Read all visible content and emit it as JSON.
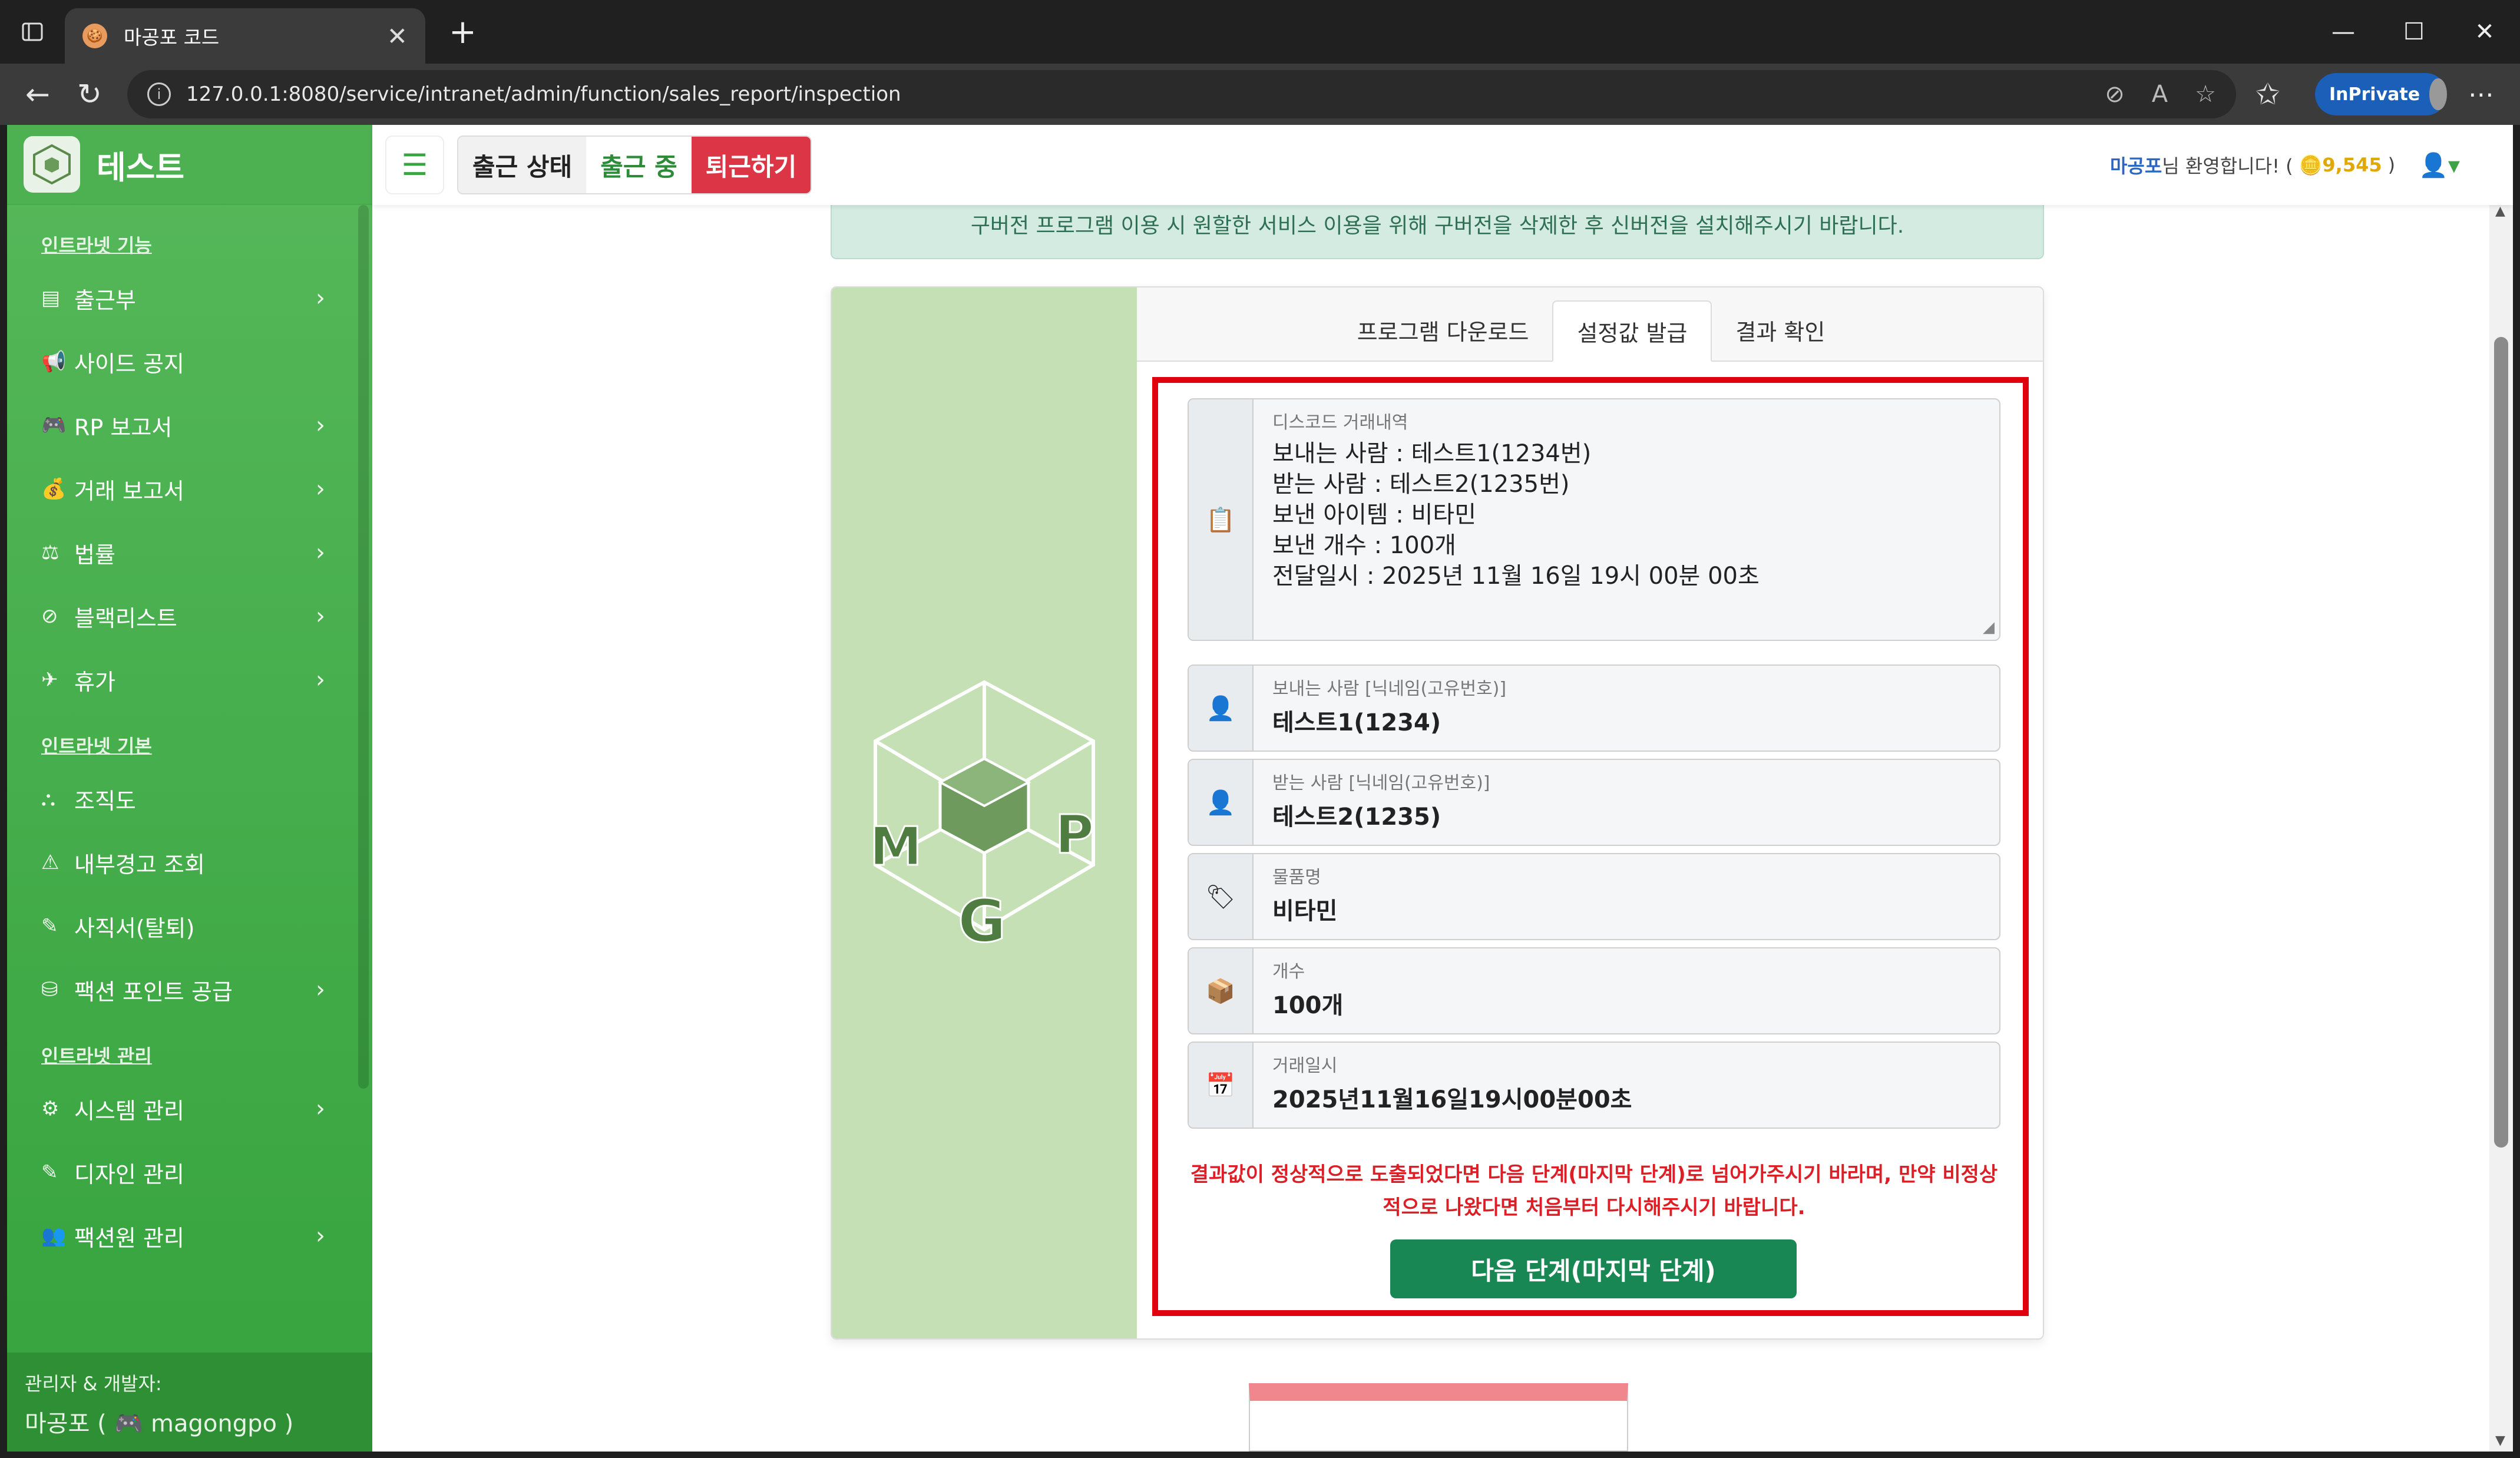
{
  "browser": {
    "tab_title": "마공포 코드",
    "favicon_glyph": "🍪",
    "url": "127.0.0.1:8080/service/intranet/admin/function/sales_report/inspection",
    "inprivate_label": "InPrivate"
  },
  "brand": {
    "name": "테스트"
  },
  "sidebar": {
    "sections": [
      {
        "heading": "인트라넷 기능",
        "items": [
          {
            "label": "출근부",
            "icon": "book-icon",
            "glyph": "▤",
            "chevron": true
          },
          {
            "label": "사이드 공지",
            "icon": "megaphone-icon",
            "glyph": "📢",
            "chevron": false
          },
          {
            "label": "RP 보고서",
            "icon": "gamepad-icon",
            "glyph": "🎮",
            "chevron": true
          },
          {
            "label": "거래 보고서",
            "icon": "money-bag-icon",
            "glyph": "💰",
            "chevron": true
          },
          {
            "label": "법률",
            "icon": "scale-icon",
            "glyph": "⚖",
            "chevron": true
          },
          {
            "label": "블랙리스트",
            "icon": "ban-icon",
            "glyph": "⊘",
            "chevron": true
          },
          {
            "label": "휴가",
            "icon": "plane-icon",
            "glyph": "✈",
            "chevron": true
          }
        ]
      },
      {
        "heading": "인트라넷 기본",
        "items": [
          {
            "label": "조직도",
            "icon": "sitemap-icon",
            "glyph": "⛬",
            "chevron": false
          },
          {
            "label": "내부경고 조회",
            "icon": "warning-icon",
            "glyph": "⚠",
            "chevron": false
          },
          {
            "label": "사직서(탈퇴)",
            "icon": "pen-icon",
            "glyph": "✎",
            "chevron": false
          },
          {
            "label": "팩션 포인트 공급",
            "icon": "coins-icon",
            "glyph": "⛁",
            "chevron": true
          }
        ]
      },
      {
        "heading": "인트라넷 관리",
        "items": [
          {
            "label": "시스템 관리",
            "icon": "gear-icon",
            "glyph": "⚙",
            "chevron": true
          },
          {
            "label": "디자인 관리",
            "icon": "brush-icon",
            "glyph": "✎",
            "chevron": false
          },
          {
            "label": "팩션원 관리",
            "icon": "users-gear-icon",
            "glyph": "👥",
            "chevron": true
          }
        ]
      }
    ],
    "footer_title": "관리자 & 개발자:",
    "footer_name": "마공포 (",
    "footer_handle": "magongpo )"
  },
  "topbar": {
    "att_status": "출근 상태",
    "att_on": "출근 중",
    "att_off": "퇴근하기",
    "welcome_user": "마공포",
    "welcome_text": "님 환영합니다! (",
    "points": "9,545",
    "welcome_close": ")"
  },
  "notice": "구버전 프로그램 이용 시 원할한 서비스 이용을 위해 구버전을 삭제한 후 신버전을 설치해주시기 바랍니다.",
  "tabs": [
    "프로그램 다운로드",
    "설정값 발급",
    "결과 확인"
  ],
  "active_tab": 1,
  "form": {
    "discord_label": "디스코드 거래내역",
    "discord_lines": [
      "보내는 사람 : 테스트1(1234번)",
      "받는 사람 : 테스트2(1235번)",
      "보낸 아이템 : 비타민",
      "보낸 개수 : 100개",
      "전달일시 : 2025년 11월 16일 19시 00분 00초"
    ],
    "sender_label": "보내는 사람 [닉네임(고유번호)]",
    "sender_value": "테스트1(1234)",
    "receiver_label": "받는 사람 [닉네임(고유번호)]",
    "receiver_value": "테스트2(1235)",
    "item_label": "물품명",
    "item_value": "비타민",
    "count_label": "개수",
    "count_value": "100개",
    "date_label": "거래일시",
    "date_value": "2025년11월16일19시00분00초",
    "warning": "결과값이 정상적으로 도출되었다면 다음 단계(마지막 단계)로 넘어가주시기 바라며, 만약 비정상적으로 나왔다면 처음부터 다시해주시기 바랍니다.",
    "next_button": "다음 단계(마지막 단계)"
  },
  "colors": {
    "sidebar": "#45ad4b",
    "accent_red": "#dc3545",
    "button_green": "#198754",
    "highlight_border": "#e0000e"
  }
}
